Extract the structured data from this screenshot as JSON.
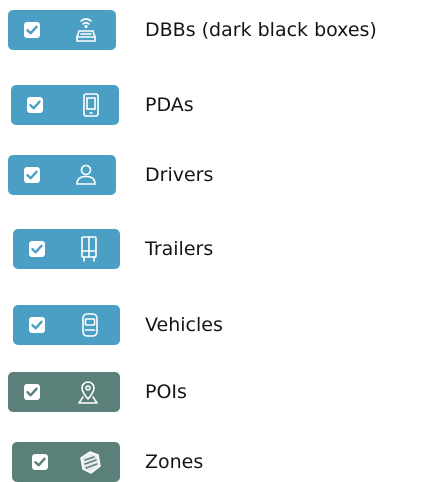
{
  "colors": {
    "pill_blue": "#4b9fc4",
    "pill_green": "#5b7f79",
    "check_fill": "#ffffff",
    "icon_color": "#ffffff",
    "label_text": "#141414"
  },
  "layers": [
    {
      "label": "DBBs (dark black boxes)",
      "checked": true,
      "icon": "black-box-wifi-icon",
      "color": "blue"
    },
    {
      "label": "PDAs",
      "checked": true,
      "icon": "pda-device-icon",
      "color": "blue"
    },
    {
      "label": "Drivers",
      "checked": true,
      "icon": "driver-person-icon",
      "color": "blue"
    },
    {
      "label": "Trailers",
      "checked": true,
      "icon": "trailer-icon",
      "color": "blue"
    },
    {
      "label": "Vehicles",
      "checked": true,
      "icon": "vehicle-icon",
      "color": "blue"
    },
    {
      "label": "POIs",
      "checked": true,
      "icon": "poi-pin-icon",
      "color": "green"
    },
    {
      "label": "Zones",
      "checked": true,
      "icon": "zone-map-icon",
      "color": "green"
    }
  ]
}
